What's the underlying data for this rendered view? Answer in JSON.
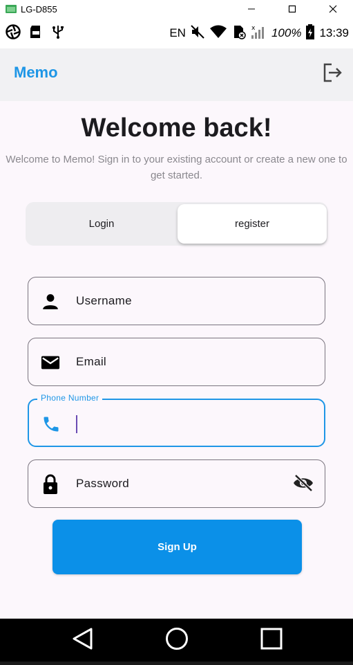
{
  "window": {
    "title": "LG-D855"
  },
  "status_bar": {
    "language": "EN",
    "battery": "100%",
    "time": "13:39"
  },
  "app_bar": {
    "title": "Memo"
  },
  "header": {
    "title": "Welcome back!",
    "subtitle": "Welcome to Memo! Sign in to your existing account or create a new one to get started."
  },
  "tabs": {
    "login_label": "Login",
    "register_label": "register",
    "selected": "register"
  },
  "form": {
    "username_label": "Username",
    "email_label": "Email",
    "phone_label": "Phone Number",
    "phone_value": "",
    "password_label": "Password"
  },
  "submit": {
    "label": "Sign Up"
  },
  "colors": {
    "accent": "#1e96e6",
    "button": "#0b90e8",
    "background": "#fcf7fc",
    "app_bar": "#f1f1f3"
  },
  "icons": {
    "username": "person-icon",
    "email": "mail-icon",
    "phone": "phone-icon",
    "password": "lock-icon",
    "toggle": "visibility-off-icon",
    "logout": "logout-icon"
  }
}
